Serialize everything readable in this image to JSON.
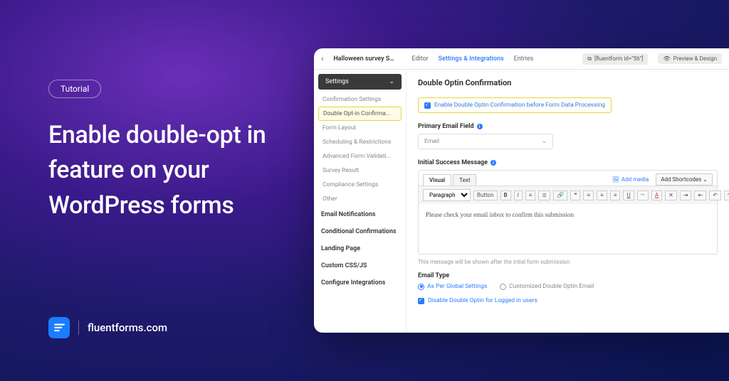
{
  "hero": {
    "chip": "Tutorial",
    "headline": "Enable double-opt in feature on your WordPress forms",
    "brand": "fluentforms.com"
  },
  "topbar": {
    "form_title": "Halloween survey Su...",
    "tabs": [
      "Editor",
      "Settings & Integrations",
      "Entries"
    ],
    "active_tab": 1,
    "shortcode": "[fluentform id=\"56\"]",
    "preview": "Preview & Design"
  },
  "sidebar": {
    "settings_label": "Settings",
    "subs": [
      "Confirmation Settings",
      "Double Opt-in Confirma...",
      "Form Layout",
      "Scheduling & Restrictions",
      "Advanced Form Validati...",
      "Survey Result",
      "Compliance Settings",
      "Other"
    ],
    "active_sub": 1,
    "nav": [
      "Email Notifications",
      "Conditional Confirmations",
      "Landing Page",
      "Custom CSS/JS",
      "Configure Integrations"
    ]
  },
  "main": {
    "heading": "Double Optin Confirmation",
    "enable_label": "Enable Double Optin Confirmation before Form Data Processing",
    "primary_label": "Primary Email Field",
    "primary_value": "Email",
    "success_label": "Initial Success Message",
    "editor": {
      "tabs": [
        "Visual",
        "Text"
      ],
      "add_media": "Add media",
      "add_shortcodes": "Add Shortcodes",
      "paragraph": "Paragraph",
      "button_label": "Button",
      "content": "Please check your email inbox to confirm this submission"
    },
    "hint": "This message will be shown after the intial form submission",
    "email_type_label": "Email Type",
    "radios": [
      "As Per Global Settings",
      "Customized Double Optin Email"
    ],
    "disable_label": "Disable Double Optin for Logged in users"
  }
}
